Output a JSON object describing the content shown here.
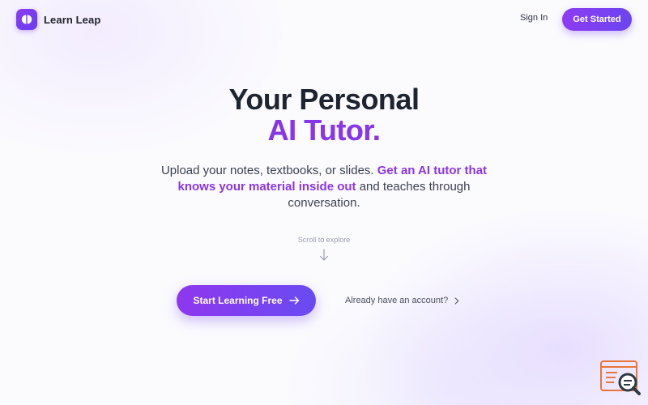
{
  "header": {
    "brand_name": "Learn Leap",
    "sign_in_label": "Sign In",
    "get_started_label": "Get Started"
  },
  "hero": {
    "title_line1": "Your Personal",
    "title_line2": "AI Tutor.",
    "subtitle_part1": "Upload your notes, textbooks, or slides. ",
    "subtitle_highlight": "Get an AI tutor that knows your material inside out",
    "subtitle_part2": " and teaches through conversation.",
    "scroll_hint": "Scroll to explore"
  },
  "cta": {
    "primary_label": "Start Learning Free",
    "secondary_label": "Already have an account?"
  },
  "icons": {
    "logo": "brand-logo-icon",
    "scroll": "arrow-down-icon",
    "primary_arrow": "arrow-right-icon",
    "secondary_chevron": "chevron-right-icon",
    "widget": "search-list-icon"
  },
  "colors": {
    "accent_start": "#8d3bf2",
    "accent_end": "#6b45f0",
    "highlight_text": "#8a35e4",
    "widget_orange": "#e8763a"
  }
}
